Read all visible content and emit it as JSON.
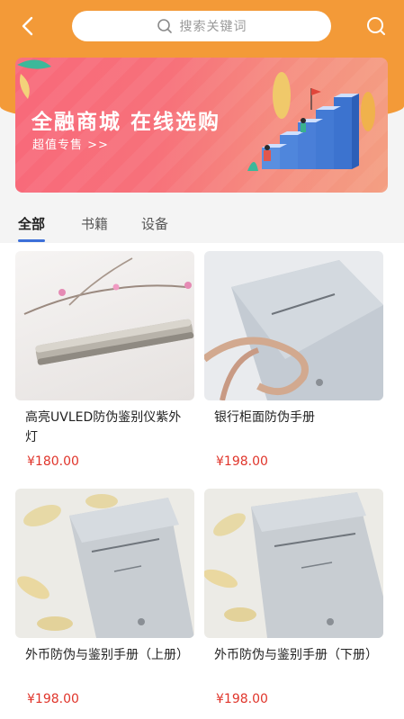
{
  "search": {
    "placeholder": "搜索关键词"
  },
  "banner": {
    "title": "全融商城  在线选购",
    "subtitle": "超值专售 >>"
  },
  "tabs": [
    {
      "label": "全部"
    },
    {
      "label": "书籍"
    },
    {
      "label": "设备"
    }
  ],
  "products": [
    {
      "title": "高亮UVLED防伪鉴别仪紫外灯",
      "price": "¥180.00"
    },
    {
      "title": "银行柜面防伪手册",
      "price": "¥198.00"
    },
    {
      "title": "外币防伪与鉴别手册（上册）",
      "price": "¥198.00"
    },
    {
      "title": "外币防伪与鉴别手册（下册）",
      "price": "¥198.00"
    }
  ],
  "colors": {
    "header": "#f39a38",
    "accent": "#3c6fd8",
    "price": "#e0352b"
  },
  "icons": [
    "back-arrow-icon",
    "search-icon",
    "search-icon"
  ]
}
